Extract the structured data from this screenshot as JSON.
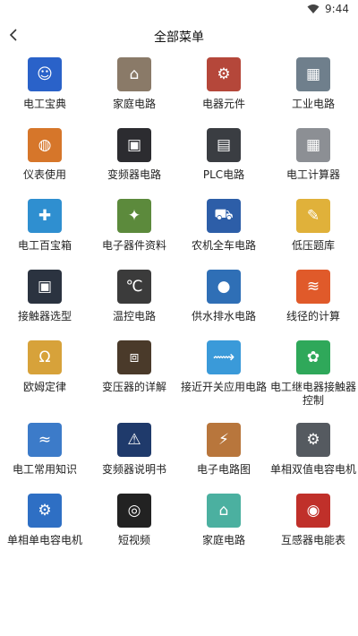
{
  "status": {
    "time": "9:44"
  },
  "header": {
    "title": "全部菜单"
  },
  "items": [
    {
      "label": "电工宝典",
      "icon": "electrician-mascot-icon",
      "glyph": "☺",
      "color": "#2a62c9"
    },
    {
      "label": "家庭电路",
      "icon": "living-room-icon",
      "glyph": "⌂",
      "color": "#8a7a68"
    },
    {
      "label": "电器元件",
      "icon": "components-icon",
      "glyph": "⚙",
      "color": "#b5473a"
    },
    {
      "label": "工业电路",
      "icon": "control-cabinet-icon",
      "glyph": "▦",
      "color": "#6f7f8c"
    },
    {
      "label": "仪表使用",
      "icon": "multimeter-icon",
      "glyph": "◍",
      "color": "#d6762a"
    },
    {
      "label": "变频器电路",
      "icon": "inverter-icon",
      "glyph": "▣",
      "color": "#2c2c30"
    },
    {
      "label": "PLC电路",
      "icon": "plc-module-icon",
      "glyph": "▤",
      "color": "#3a3d42"
    },
    {
      "label": "电工计算器",
      "icon": "calculator-icon",
      "glyph": "▦",
      "color": "#8c8f94"
    },
    {
      "label": "电工百宝箱",
      "icon": "toolbox-icon",
      "glyph": "✚",
      "color": "#2f8fd0"
    },
    {
      "label": "电子器件资料",
      "icon": "electronic-parts-icon",
      "glyph": "✦",
      "color": "#5c8a3c"
    },
    {
      "label": "农机全车电路",
      "icon": "tractor-icon",
      "glyph": "⛟",
      "color": "#2d5ea8"
    },
    {
      "label": "低压题库",
      "icon": "exam-bank-icon",
      "glyph": "✎",
      "color": "#e0b13a"
    },
    {
      "label": "接触器选型",
      "icon": "contactor-icon",
      "glyph": "▣",
      "color": "#2b3340"
    },
    {
      "label": "温控电路",
      "icon": "thermostat-icon",
      "glyph": "℃",
      "color": "#3b3b3b"
    },
    {
      "label": "供水排水电路",
      "icon": "float-switch-icon",
      "glyph": "●",
      "color": "#2f6fb6"
    },
    {
      "label": "线径的计算",
      "icon": "wire-gauge-icon",
      "glyph": "≋",
      "color": "#e05a2a"
    },
    {
      "label": "欧姆定律",
      "icon": "ohm-law-wheel-icon",
      "glyph": "Ω",
      "color": "#d7a23a"
    },
    {
      "label": "变压器的详解",
      "icon": "transformer-icon",
      "glyph": "⧈",
      "color": "#4a3a2a"
    },
    {
      "label": "接近开关应用电路",
      "icon": "proximity-switch-icon",
      "glyph": "⟿",
      "color": "#3a9ad9"
    },
    {
      "label": "电工继电器接触器控制",
      "icon": "relay-palm-icon",
      "glyph": "✿",
      "color": "#2fa85a"
    },
    {
      "label": "电工常用知识",
      "icon": "knowledge-icon",
      "glyph": "≈",
      "color": "#3c7bc9"
    },
    {
      "label": "变频器说明书",
      "icon": "warning-manual-icon",
      "glyph": "⚠",
      "color": "#1f3a6b"
    },
    {
      "label": "电子电路图",
      "icon": "circuit-parts-icon",
      "glyph": "⚡",
      "color": "#b8763c"
    },
    {
      "label": "单相双值电容电机",
      "icon": "motor-capacitor-icon",
      "glyph": "⚙",
      "color": "#555a60"
    },
    {
      "label": "单相单电容电机",
      "icon": "blue-motor-icon",
      "glyph": "⚙",
      "color": "#2e6fc4"
    },
    {
      "label": "短视频",
      "icon": "video-reel-icon",
      "glyph": "◎",
      "color": "#222222"
    },
    {
      "label": "家庭电路",
      "icon": "house-icon",
      "glyph": "⌂",
      "color": "#4bb0a0"
    },
    {
      "label": "互感器电能表",
      "icon": "current-transformer-icon",
      "glyph": "◉",
      "color": "#c0302a"
    }
  ]
}
